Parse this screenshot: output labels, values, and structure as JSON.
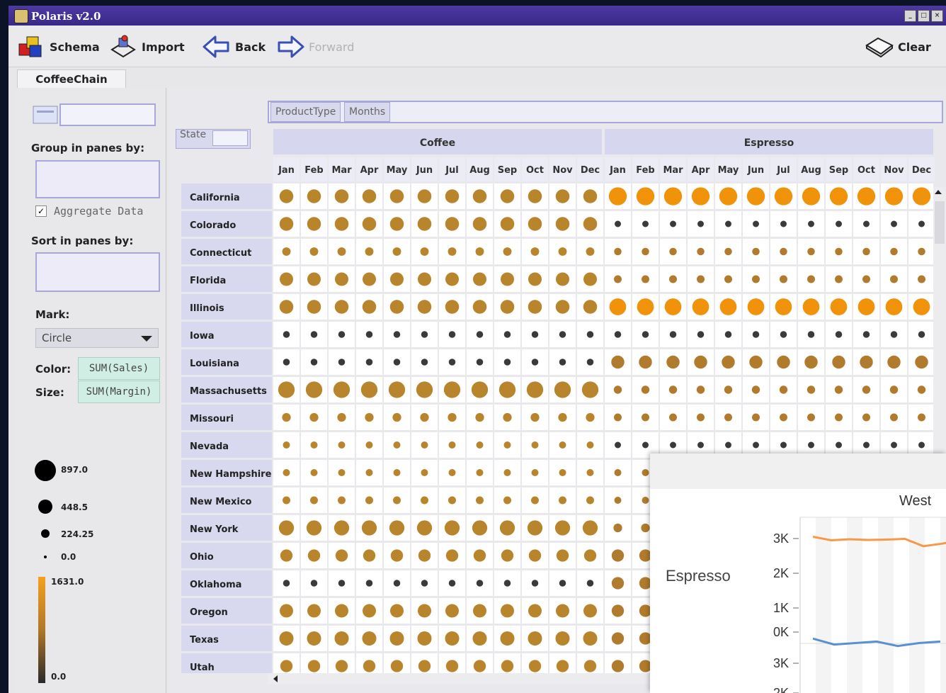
{
  "window": {
    "title": "Polaris v2.0"
  },
  "toolbar": {
    "schema_label": "Schema",
    "import_label": "Import",
    "back_label": "Back",
    "forward_label": "Forward",
    "clear_label": "Clear"
  },
  "tab": {
    "label": "CoffeeChain"
  },
  "left_panel": {
    "group_label": "Group in panes by:",
    "aggregate_label": "Aggregate Data",
    "aggregate_checked": true,
    "sort_label": "Sort in panes by:",
    "mark_label": "Mark:",
    "mark_value": "Circle",
    "color_label": "Color:",
    "color_field": "SUM(Sales)",
    "size_label": "Size:",
    "size_field": "SUM(Margin)",
    "size_legend": [
      "897.0",
      "448.5",
      "224.25",
      "0.0"
    ],
    "color_legend": {
      "max": "1631.0",
      "min": "0.0"
    }
  },
  "shelves": {
    "columns": [
      "ProductType",
      "Months"
    ],
    "rows": [
      "State"
    ]
  },
  "colors": {
    "coffee": "#b8852c",
    "espresso_high": "#f0920a",
    "espresso_mid": "#b07b2c",
    "small": "#3a3a3a"
  },
  "chart_data": [
    {
      "type": "scatter",
      "title": "",
      "groups": [
        "Coffee",
        "Espresso"
      ],
      "months": [
        "Jan",
        "Feb",
        "Mar",
        "Apr",
        "May",
        "Jun",
        "Jul",
        "Aug",
        "Sep",
        "Oct",
        "Nov",
        "Dec"
      ],
      "states": [
        "California",
        "Colorado",
        "Connecticut",
        "Florida",
        "Illinois",
        "Iowa",
        "Louisiana",
        "Massachusetts",
        "Missouri",
        "Nevada",
        "New Hampshire",
        "New Mexico",
        "New York",
        "Ohio",
        "Oklahoma",
        "Oregon",
        "Texas",
        "Utah"
      ],
      "size_encoding": "SUM(Margin)",
      "color_encoding": "SUM(Sales)",
      "margin_by_state": {
        "Coffee": [
          380,
          380,
          140,
          360,
          380,
          90,
          90,
          540,
          150,
          100,
          100,
          120,
          450,
          300,
          90,
          360,
          400,
          300
        ],
        "Espresso": [
          640,
          80,
          110,
          120,
          560,
          90,
          340,
          130,
          120,
          80,
          100,
          100,
          150,
          300,
          300,
          300,
          300,
          300
        ]
      },
      "sales_by_state": {
        "Coffee": [
          800,
          800,
          450,
          780,
          800,
          300,
          300,
          900,
          450,
          300,
          300,
          400,
          850,
          700,
          300,
          780,
          800,
          700
        ],
        "Espresso": [
          1600,
          400,
          450,
          800,
          1500,
          300,
          700,
          600,
          450,
          300,
          400,
          400,
          600,
          700,
          700,
          700,
          700,
          700
        ]
      }
    },
    {
      "type": "line",
      "title": "West",
      "row_labels": [
        "Espresso"
      ],
      "yticks": [
        "3K",
        "2K",
        "1K",
        "0K"
      ],
      "series_values": [
        {
          "values": [
            3050,
            2950,
            2980,
            2960,
            2970,
            2990,
            2780,
            2850,
            2950,
            3000
          ]
        },
        {
          "values": [
            3400,
            3200,
            3250,
            3300,
            3150,
            3250,
            3300
          ]
        }
      ]
    }
  ],
  "overlay": {
    "column_header": "West",
    "row_header": "Espresso",
    "yticks_top": [
      "3K",
      "2K",
      "1K",
      "0K"
    ],
    "yticks_bottom": [
      "3K",
      "2K"
    ]
  }
}
